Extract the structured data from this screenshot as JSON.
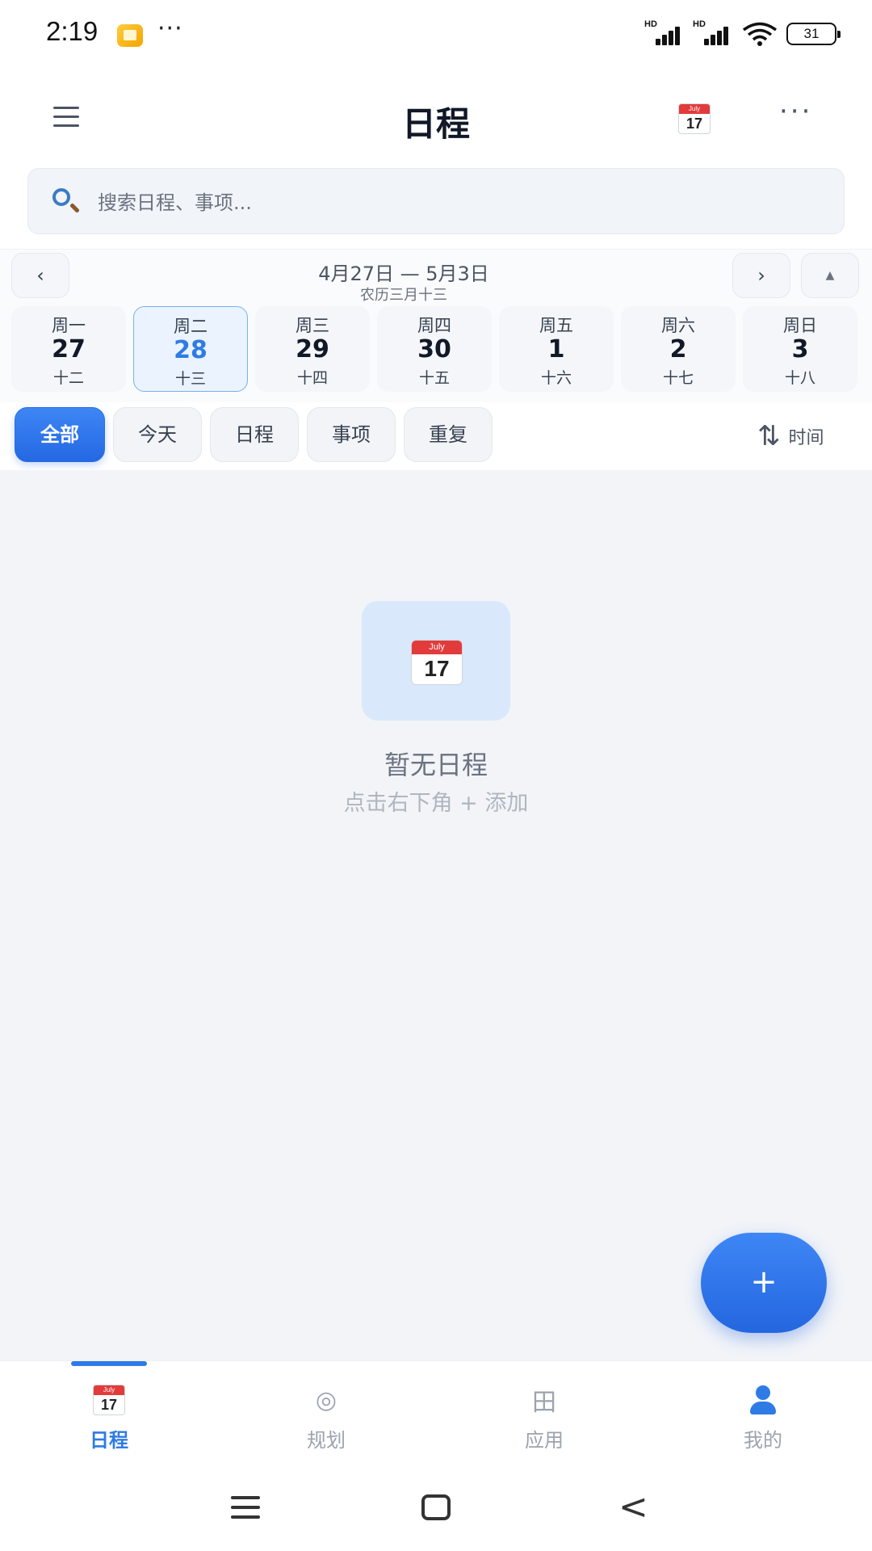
{
  "status_bar": {
    "time": "2:19",
    "overflow": "···",
    "signal_1_label": "HD",
    "signal_2_label": "HD",
    "battery": "31"
  },
  "header": {
    "title": "日程",
    "menu_icon": "hamburger-icon",
    "calendar_icon": "calendar-icon",
    "calendar_icon_month": "July",
    "calendar_icon_day": "17",
    "more": "···"
  },
  "search": {
    "placeholder": "搜索日程、事项..."
  },
  "week": {
    "prev": "‹",
    "next": "›",
    "collapse": "▲",
    "range": "4月27日 — 5月3日",
    "lunar": "农历三月十三",
    "days": [
      {
        "weekday": "周一",
        "date": "27",
        "lunar": "十二",
        "selected": false
      },
      {
        "weekday": "周二",
        "date": "28",
        "lunar": "十三",
        "selected": true
      },
      {
        "weekday": "周三",
        "date": "29",
        "lunar": "十四",
        "selected": false
      },
      {
        "weekday": "周四",
        "date": "30",
        "lunar": "十五",
        "selected": false
      },
      {
        "weekday": "周五",
        "date": "1",
        "lunar": "十六",
        "selected": false
      },
      {
        "weekday": "周六",
        "date": "2",
        "lunar": "十七",
        "selected": false
      },
      {
        "weekday": "周日",
        "date": "3",
        "lunar": "十八",
        "selected": false
      }
    ]
  },
  "filters": {
    "chips": [
      "全部",
      "今天",
      "日程",
      "事项",
      "重复"
    ],
    "active": "全部",
    "sort_icon": "⇅",
    "sort_label": "时间"
  },
  "empty_state": {
    "icon_month": "July",
    "icon_day": "17",
    "title": "暂无日程",
    "hint": "点击右下角 + 添加"
  },
  "fab": {
    "label": "+"
  },
  "tabs": [
    {
      "label": "日程",
      "icon": "calendar-icon",
      "active": true
    },
    {
      "label": "规划",
      "icon": "target-icon",
      "glyph": "◎",
      "active": false
    },
    {
      "label": "应用",
      "icon": "grid-icon",
      "glyph": "田",
      "active": false
    },
    {
      "label": "我的",
      "icon": "person-icon",
      "active": false
    }
  ],
  "colors": {
    "accent": "#2f7be6",
    "fab": "#2a6de5",
    "content_bg": "#f2f4f8",
    "selected_day_bg": "#eaf3ff"
  },
  "system_nav": {
    "back": "<"
  }
}
